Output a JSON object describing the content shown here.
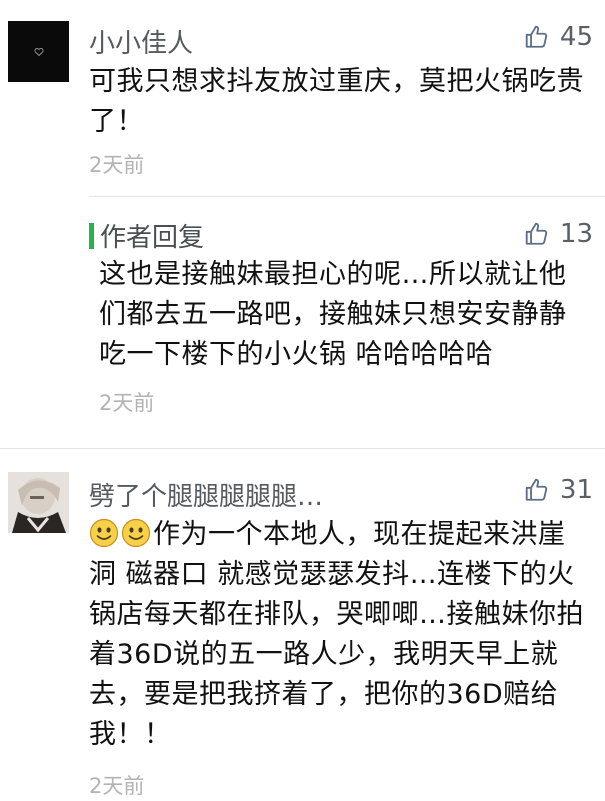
{
  "comments": [
    {
      "username": "小小佳人",
      "likes": "45",
      "text": "可我只想求抖友放过重庆，莫把火锅吃贵了！",
      "time": "2天前"
    },
    {
      "username": "劈了个腿腿腿腿腿…",
      "likes": "31",
      "text": "作为一个本地人，现在提起来洪崖洞 磁器口 就感觉瑟瑟发抖…连楼下的火锅店每天都在排队，哭唧唧…接触妹你拍着36D说的五一路人少，我明天早上就去，要是把我挤着了，把你的36D赔给我！！",
      "time": "2天前"
    }
  ],
  "reply": {
    "label": "作者回复",
    "likes": "13",
    "text": "这也是接触妹最担心的呢…所以就让他们都去五一路吧，接触妹只想安安静静吃一下楼下的小火锅 哈哈哈哈哈",
    "time": "2天前"
  },
  "icons": {
    "like": "thumbs-up-icon",
    "emoji": "smiling-face-icon",
    "heart": "heart-icon"
  },
  "colors": {
    "reply_accent": "#2bb24c",
    "time": "#b3b3b3",
    "username": "#555a5f"
  }
}
